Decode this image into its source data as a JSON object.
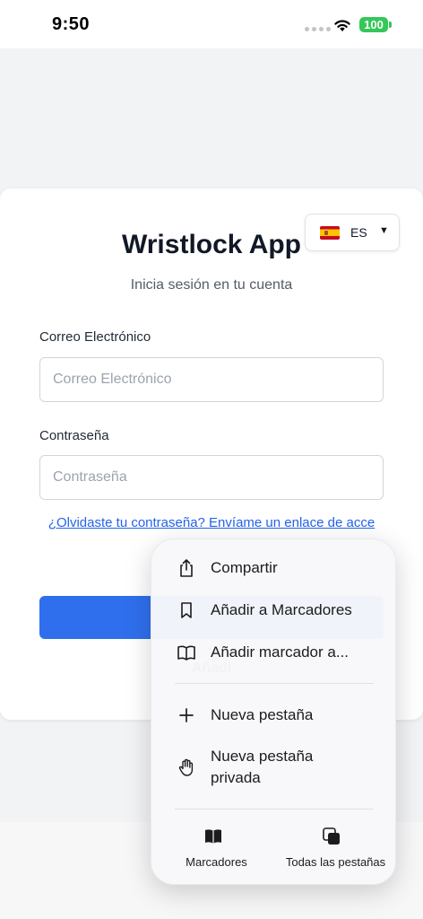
{
  "status_bar": {
    "time": "9:50",
    "battery": "100",
    "battery_color": "#34c759"
  },
  "login": {
    "title": "Wristlock App",
    "subtitle": "Inicia sesión en tu cuenta",
    "language": {
      "code": "ES",
      "flag": "spain-flag-icon",
      "caret": "▼"
    },
    "email": {
      "label": "Correo Electrónico",
      "placeholder": "Correo Electrónico",
      "value": ""
    },
    "password": {
      "label": "Contraseña",
      "placeholder": "Contraseña",
      "value": ""
    },
    "forgot_link": "¿Olvidaste tu contraseña? Envíame un enlace de acce",
    "login_button": "",
    "add_bookmark_text": "Añadi",
    "accent_color": "#2f6fed"
  },
  "share_menu": {
    "items": [
      {
        "label": "Compartir",
        "icon": "share-icon"
      },
      {
        "label": "Añadir a Marcadores",
        "icon": "bookmark-icon"
      },
      {
        "label": "Añadir marcador a...",
        "icon": "open-book-icon"
      },
      {
        "label": "Nueva pestaña",
        "icon": "plus-icon"
      },
      {
        "label": "Nueva pestaña privada",
        "icon": "hand-icon"
      }
    ],
    "bottom_buttons": [
      {
        "label": "Marcadores",
        "icon": "bookmarks-icon"
      },
      {
        "label": "Todas las pestañas",
        "icon": "tabs-icon"
      }
    ]
  }
}
